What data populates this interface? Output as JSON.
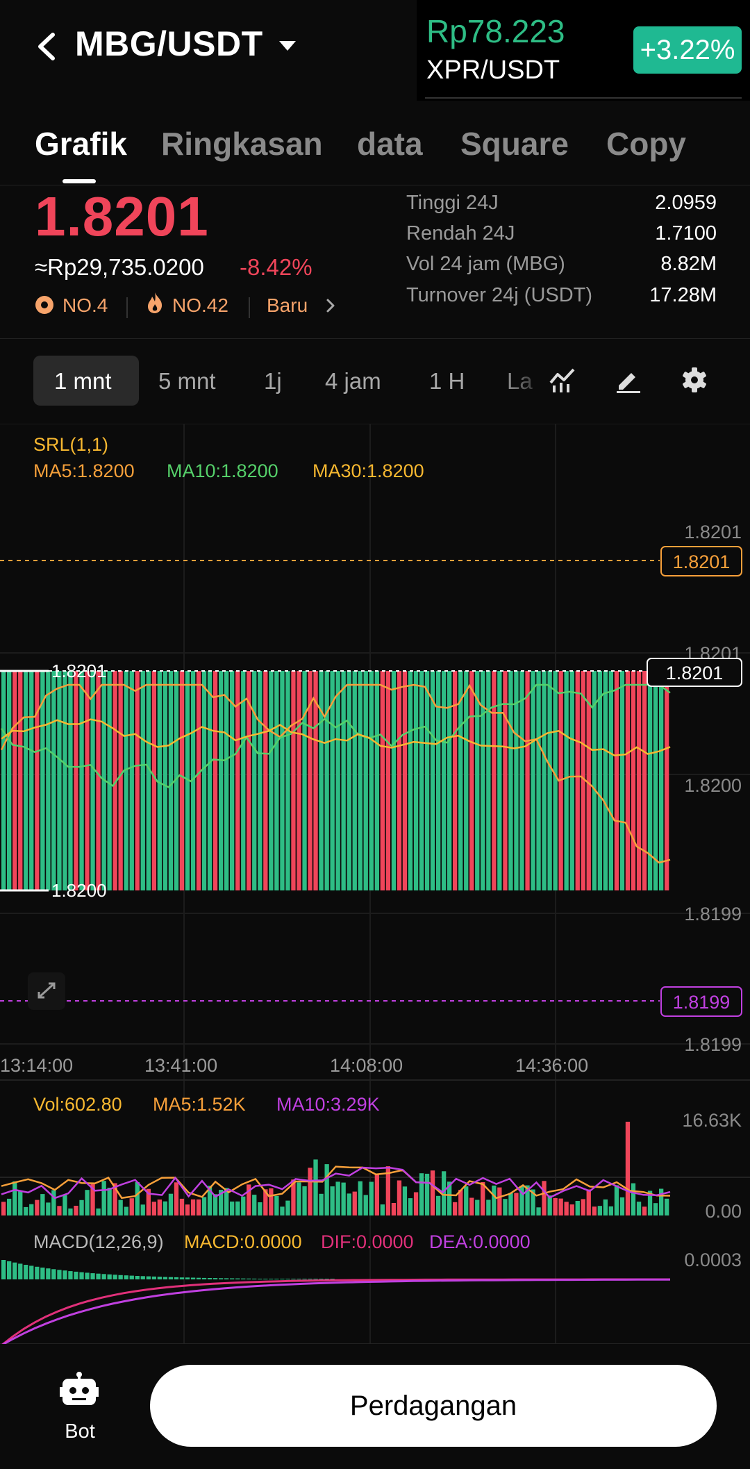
{
  "header": {
    "pair": "MBG/USDT",
    "ticker_price": "Rp78.223",
    "ticker_pair": "XPR/USDT",
    "ticker_change": "+3.22%"
  },
  "tabs": [
    {
      "label": "Grafik",
      "active": true
    },
    {
      "label": "Ringkasan",
      "active": false
    },
    {
      "label": "data",
      "active": false
    },
    {
      "label": "Square",
      "active": false
    },
    {
      "label": "Copy",
      "active": false
    }
  ],
  "price": {
    "last": "1.8201",
    "idr": "≈Rp29,735.0200",
    "change": "-8.42%",
    "rank1": "NO.4",
    "rank2": "NO.42",
    "tag": "Baru"
  },
  "stats": [
    {
      "label": "Tinggi 24J",
      "value": "2.0959"
    },
    {
      "label": "Rendah 24J",
      "value": "1.7100"
    },
    {
      "label": "Vol 24 jam (MBG)",
      "value": "8.82M"
    },
    {
      "label": "Turnover 24j (USDT)",
      "value": "17.28M"
    }
  ],
  "intervals": [
    {
      "label": "1 mnt",
      "active": true
    },
    {
      "label": "5 mnt",
      "active": false
    },
    {
      "label": "1j",
      "active": false
    },
    {
      "label": "4 jam",
      "active": false
    },
    {
      "label": "1 H",
      "active": false
    },
    {
      "label": "La",
      "active": false
    }
  ],
  "tool_icons": [
    "indicator-icon",
    "draw-icon",
    "gear-icon"
  ],
  "legends": {
    "srl": "SRL(1,1)",
    "ma5": "MA5:1.8200",
    "ma10": "MA10:1.8200",
    "ma30": "MA30:1.8200",
    "vol": "Vol:602.80",
    "vma5": "MA5:1.52K",
    "vma10": "MA10:3.29K",
    "macd": "MACD(12,26,9)",
    "macd_val": "MACD:0.0000",
    "dif": "DIF:0.0000",
    "dea": "DEA:0.0000"
  },
  "colors": {
    "up": "#2ebd85",
    "down": "#f0455a",
    "ma5": "#f7a03a",
    "ma10": "#55d06a",
    "ma30": "#f7b830",
    "purple": "#c040e0",
    "pink": "#e0307a"
  },
  "chart_data": {
    "type": "candlestick",
    "y_ticks": [
      "1.8201",
      "1.8201",
      "1.8200",
      "1.8199",
      "1.8199"
    ],
    "x_ticks": [
      "13:14:00",
      "13:41:00",
      "14:08:00",
      "14:36:00"
    ],
    "high_label": "1.8201",
    "low_label": "1.8200",
    "current_price_tag": "1.8201",
    "upper_line_tag": "1.8201",
    "lower_line_tag": "1.8199",
    "volume_axis": [
      "16.63K",
      "0.00"
    ],
    "macd_axis": [
      "0.0003"
    ]
  },
  "bottom": {
    "bot_label": "Bot",
    "trade_label": "Perdagangan"
  }
}
